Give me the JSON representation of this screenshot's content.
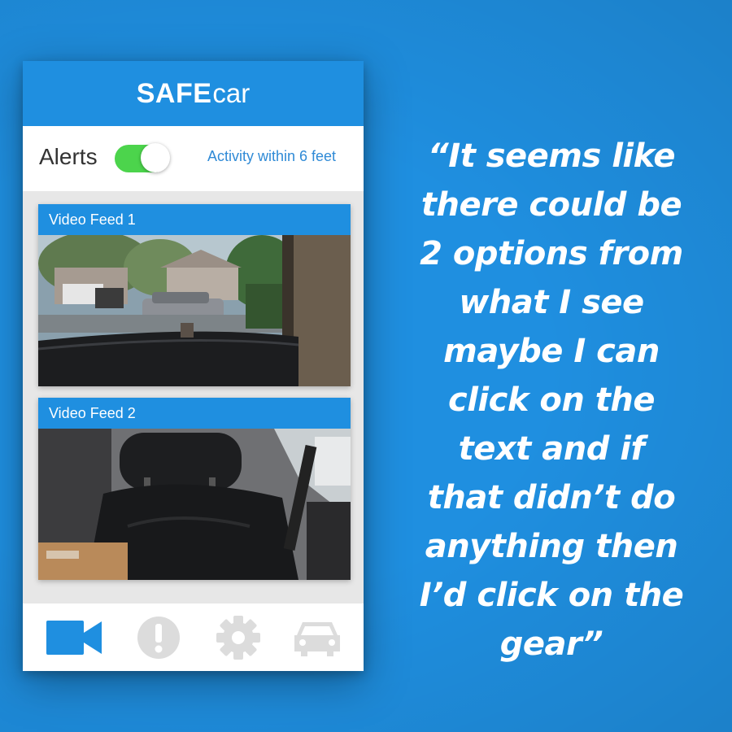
{
  "app": {
    "brand_bold": "SAFE",
    "brand_light": "car"
  },
  "alerts": {
    "label": "Alerts",
    "toggle_on": true,
    "activity_link": "Activity within 6 feet"
  },
  "feeds": [
    {
      "title": "Video Feed 1"
    },
    {
      "title": "Video Feed 2"
    }
  ],
  "tabbar": {
    "items": [
      {
        "icon": "video-camera-icon",
        "active": true
      },
      {
        "icon": "exclamation-icon",
        "active": false
      },
      {
        "icon": "gear-icon",
        "active": false
      },
      {
        "icon": "car-icon",
        "active": false
      }
    ]
  },
  "quote": {
    "lines": [
      "“It seems like",
      "there could be",
      "2 options from",
      "what I see",
      "maybe I can",
      "click on the",
      "text and if",
      "that didn’t do",
      "anything then",
      "I’d click on the",
      "gear”"
    ]
  },
  "colors": {
    "brand_blue": "#1f8fe0",
    "toggle_green": "#4cd44c",
    "inactive_icon": "#dcdcdc",
    "link_blue": "#2f8ad6"
  }
}
